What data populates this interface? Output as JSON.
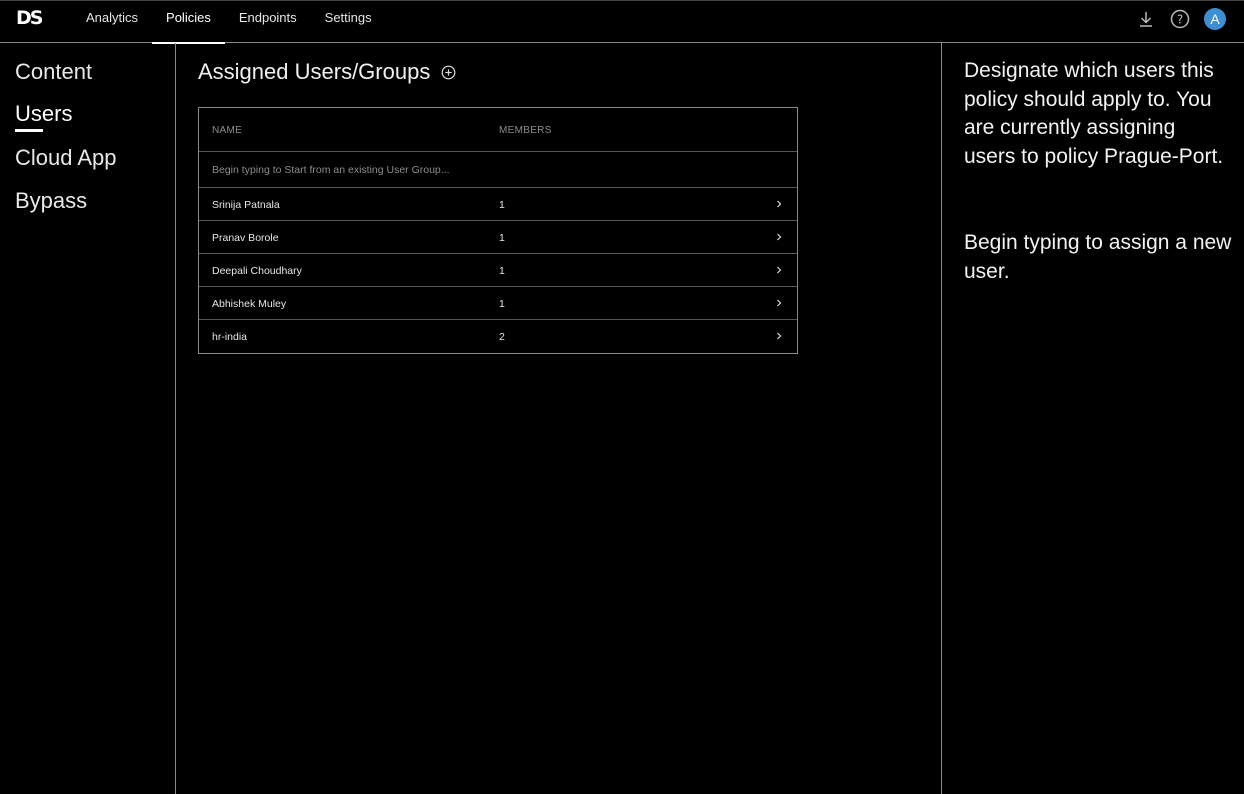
{
  "brand": {
    "logo": "DS"
  },
  "nav": {
    "items": [
      {
        "label": "Analytics"
      },
      {
        "label": "Policies"
      },
      {
        "label": "Endpoints"
      },
      {
        "label": "Settings"
      }
    ],
    "active": "Policies"
  },
  "topbar": {
    "icons": [
      "download-icon",
      "help-icon"
    ],
    "avatar_initial": "A",
    "avatar_color": "#3d8fd1"
  },
  "sidebar": {
    "items": [
      {
        "label": "Content"
      },
      {
        "label": "Users"
      },
      {
        "label": "Cloud App"
      },
      {
        "label": "Bypass"
      }
    ],
    "active": "Users"
  },
  "main": {
    "title": "Assigned Users/Groups",
    "table": {
      "columns": {
        "name": "NAME",
        "members": "MEMBERS"
      },
      "search_placeholder": "Begin typing to Start from an existing User Group...",
      "rows": [
        {
          "name": "Srinija Patnala",
          "members": "1"
        },
        {
          "name": "Pranav Borole",
          "members": "1"
        },
        {
          "name": "Deepali Choudhary",
          "members": "1"
        },
        {
          "name": "Abhishek Muley",
          "members": "1"
        },
        {
          "name": "hr-india",
          "members": "2"
        }
      ]
    }
  },
  "help": {
    "paragraph1": "Designate which users this policy should apply to. You are currently assigning users to policy Prague-Port.",
    "paragraph2": "Begin typing to assign a new user."
  }
}
